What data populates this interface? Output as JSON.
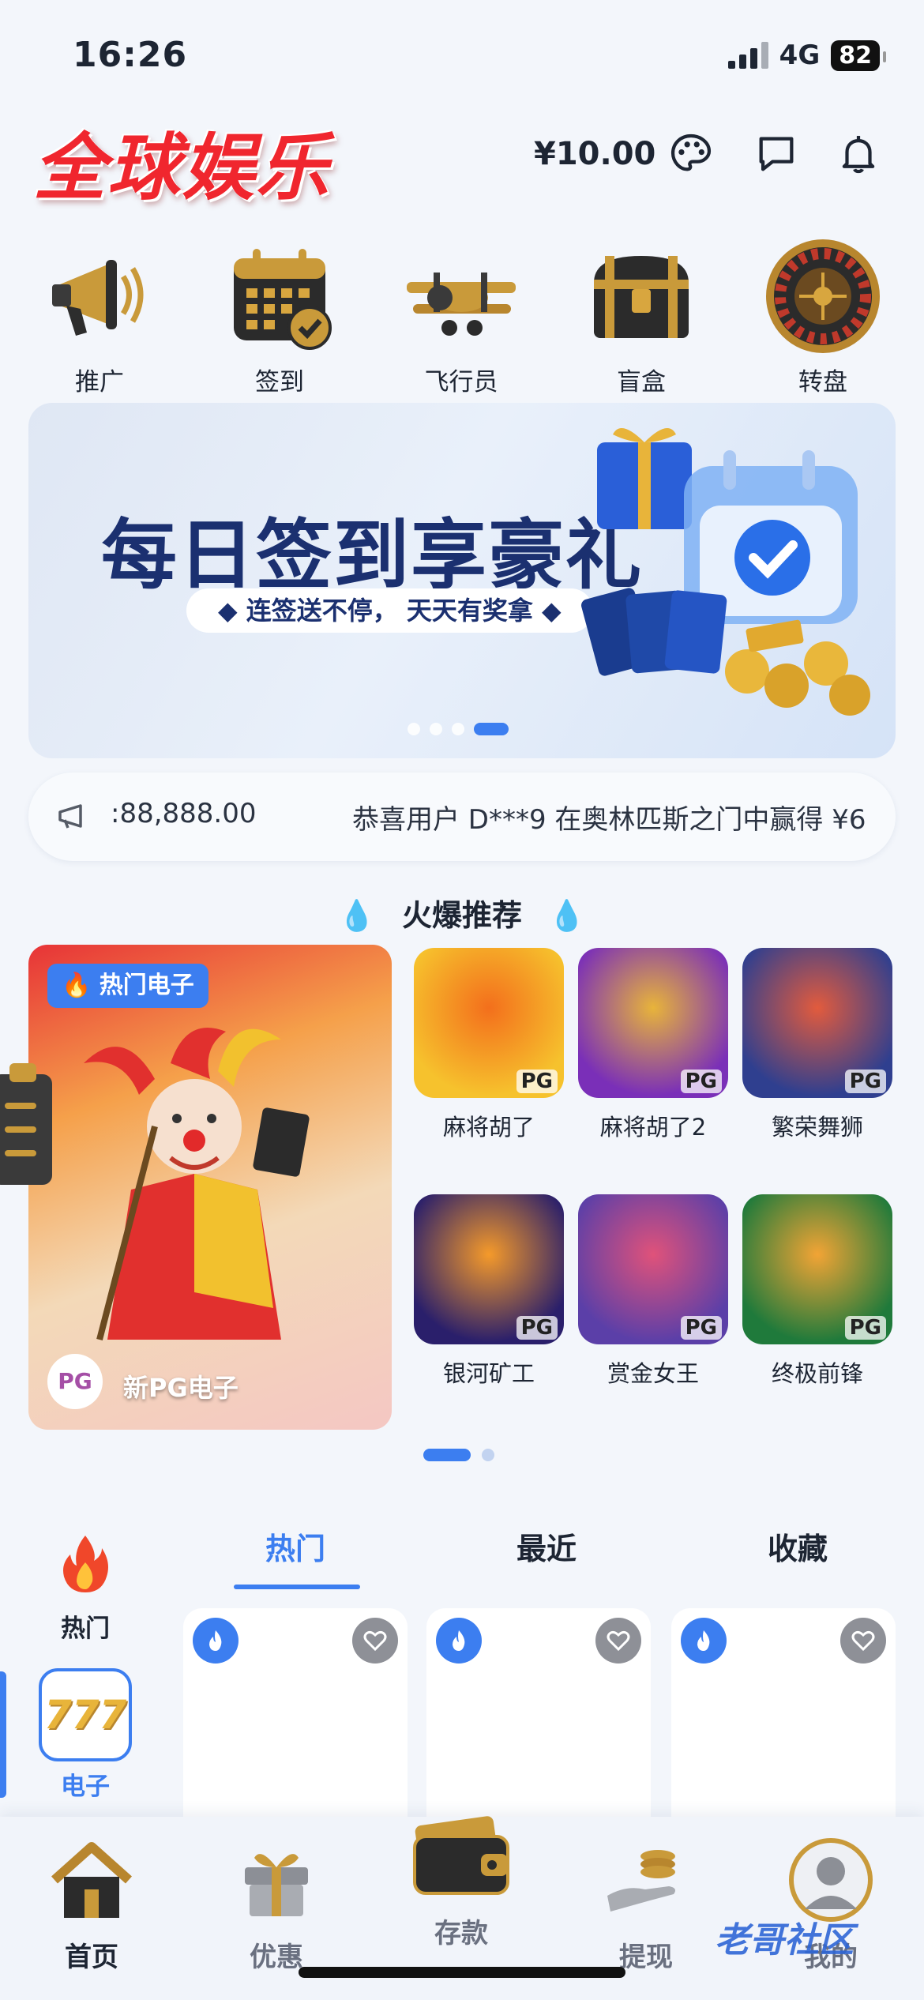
{
  "status_bar": {
    "time": "16:26",
    "network": "4G",
    "battery": "82"
  },
  "header": {
    "logo": "全球娱乐",
    "balance": "¥10.00",
    "icons": [
      "palette-icon",
      "message-icon",
      "bell-icon"
    ]
  },
  "quick_nav": [
    {
      "label": "推广",
      "icon": "megaphone-icon"
    },
    {
      "label": "签到",
      "icon": "calendar-icon"
    },
    {
      "label": "飞行员",
      "icon": "airplane-icon"
    },
    {
      "label": "盲盒",
      "icon": "treasure-chest-icon"
    },
    {
      "label": "转盘",
      "icon": "roulette-icon"
    }
  ],
  "banner": {
    "title": "每日签到享豪礼",
    "subtitle": "◆ 连签送不停， 天天有奖拿 ◆",
    "active_slide": 4,
    "slide_count": 4
  },
  "marquee": {
    "text_left": ":88,888.00",
    "text_right": "恭喜用户 D***9 在奥林匹斯之门中赢得 ¥6"
  },
  "hot_section": {
    "title": "火爆推荐",
    "featured": {
      "tag": "🔥 热门电子",
      "name": "新PG电子",
      "badge": "PG"
    },
    "games": [
      {
        "name": "麻将胡了",
        "provider": "PG",
        "colors": [
          "#f6c22d",
          "#f36f1c"
        ]
      },
      {
        "name": "麻将胡了2",
        "provider": "PG",
        "colors": [
          "#7a2fb8",
          "#e8b43a"
        ]
      },
      {
        "name": "繁荣舞狮",
        "provider": "PG",
        "colors": [
          "#2f3f8f",
          "#e25b3d"
        ]
      },
      {
        "name": "银河矿工",
        "provider": "PG",
        "colors": [
          "#2a1f6b",
          "#f59a2a"
        ]
      },
      {
        "name": "赏金女王",
        "provider": "PG",
        "colors": [
          "#5b3fa8",
          "#e0527a"
        ]
      },
      {
        "name": "终极前锋",
        "provider": "PG",
        "colors": [
          "#1f7a3b",
          "#f2a435"
        ]
      }
    ],
    "page": 1,
    "page_count": 2
  },
  "categories": [
    {
      "label": "热门",
      "icon": "fire-icon",
      "active": false
    },
    {
      "label": "电子",
      "icon": "slot-777-icon",
      "active": true
    }
  ],
  "tabs": [
    {
      "label": "热门",
      "active": true
    },
    {
      "label": "最近",
      "active": false
    },
    {
      "label": "收藏",
      "active": false
    }
  ],
  "tabbar": [
    {
      "label": "首页",
      "icon": "home-icon",
      "active": true
    },
    {
      "label": "优惠",
      "icon": "gift-icon",
      "active": false
    },
    {
      "label": "存款",
      "icon": "wallet-icon",
      "active": false
    },
    {
      "label": "提现",
      "icon": "coins-hand-icon",
      "active": false
    },
    {
      "label": "我的",
      "icon": "avatar-icon",
      "active": false
    }
  ],
  "watermark": "老哥社区",
  "colors": {
    "accent": "#3c7ef0",
    "logo_red": "#f0262e",
    "background": "#f3f6fb"
  }
}
